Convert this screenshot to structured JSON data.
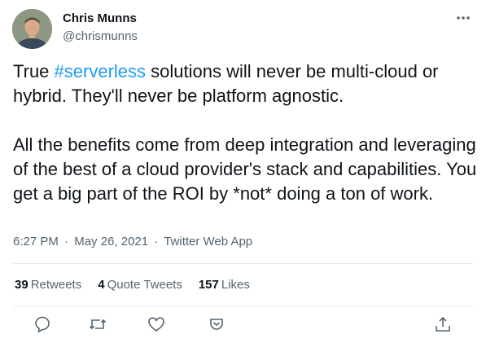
{
  "author": {
    "name": "Chris Munns",
    "handle": "@chrismunns",
    "avatar_icon": "profile-photo"
  },
  "tweet": {
    "line1_prefix": "True ",
    "hashtag": "#serverless",
    "line1_rest": " solutions will never be multi-cloud or hybrid. They'll never be platform agnostic.",
    "paragraph2": "All the benefits come from deep integration and leveraging of the best of a cloud provider's stack and capabilities. You get a big part of the ROI by *not* doing a ton of work."
  },
  "meta": {
    "time": "6:27 PM",
    "sep": "·",
    "date": "May 26, 2021",
    "source": "Twitter Web App"
  },
  "stats": {
    "retweets_count": "39",
    "retweets_label": "Retweets",
    "quotes_count": "4",
    "quotes_label": "Quote Tweets",
    "likes_count": "157",
    "likes_label": "Likes"
  },
  "actions": [
    "reply-icon",
    "retweet-icon",
    "like-icon",
    "share-icon",
    "share-upload-icon"
  ],
  "colors": {
    "hashtag": "#1d9bf0",
    "secondary_text": "#536471",
    "divider": "#e6ecf0"
  }
}
